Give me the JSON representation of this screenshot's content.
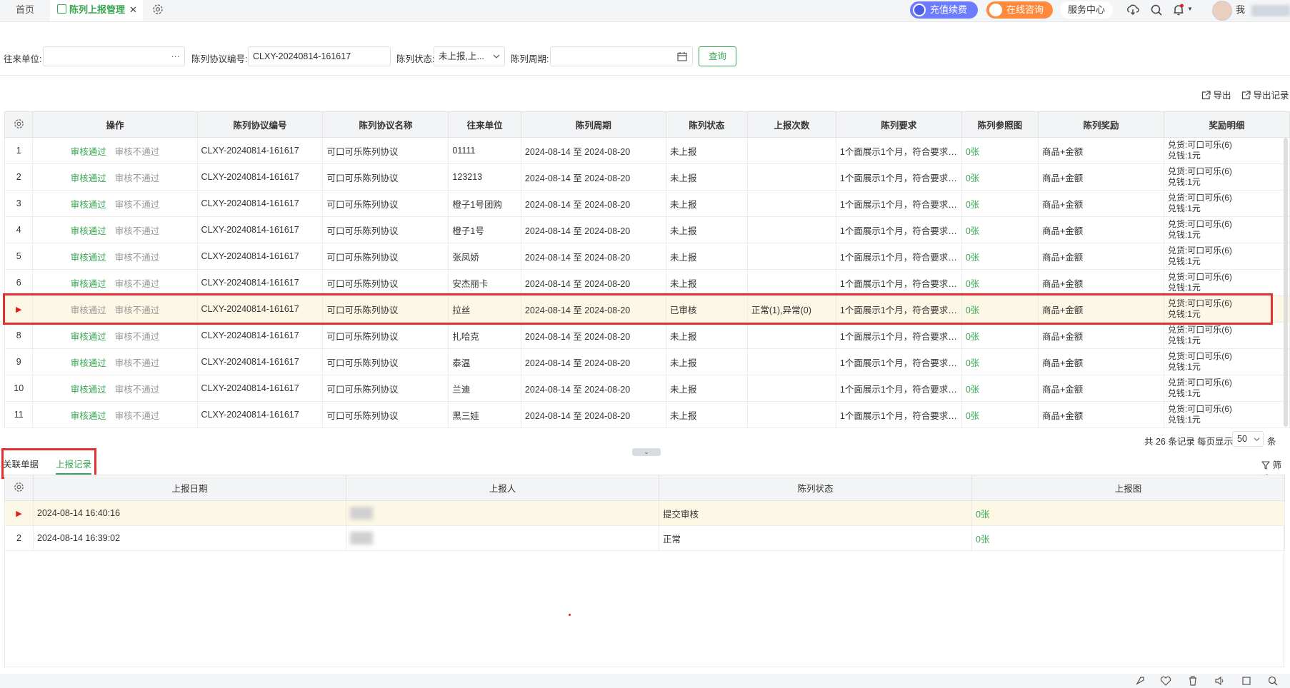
{
  "tabs": {
    "home": "首页",
    "active": "陈列上报管理",
    "close": "✕"
  },
  "topbar": {
    "recharge": "充值续费",
    "consult": "在线咨询",
    "service": "服务中心",
    "username": "我"
  },
  "filters": {
    "unit_label": "往来单位:",
    "unit_value": "",
    "unit_more": "···",
    "protocol_label": "陈列协议编号:",
    "protocol_value": "CLXY-20240814-161617",
    "status_label": "陈列状态:",
    "status_value": "未上报,上...",
    "period_label": "陈列周期:",
    "period_value": "",
    "query": "查询"
  },
  "toolbar": {
    "export": "导出",
    "export_log": "导出记录"
  },
  "table": {
    "headers": [
      "操作",
      "陈列协议编号",
      "陈列协议名称",
      "往来单位",
      "陈列周期",
      "陈列状态",
      "上报次数",
      "陈列要求",
      "陈列参照图",
      "陈列奖励",
      "奖励明细"
    ],
    "approve": "审核通过",
    "reject": "审核不通过",
    "rows": [
      {
        "idx": "1",
        "code": "CLXY-20240814-161617",
        "name": "可口可乐陈列协议",
        "unit": "01111",
        "period": "2024-08-14 至 2024-08-20",
        "status": "未上报",
        "count": "",
        "req": "1个面展示1个月，符合要求1...",
        "img": "0张",
        "reward": "商品+金额",
        "d1": "兑货:可口可乐(6)",
        "d2": "兑钱:1元"
      },
      {
        "idx": "2",
        "code": "CLXY-20240814-161617",
        "name": "可口可乐陈列协议",
        "unit": "123213",
        "period": "2024-08-14 至 2024-08-20",
        "status": "未上报",
        "count": "",
        "req": "1个面展示1个月，符合要求1...",
        "img": "0张",
        "reward": "商品+金额",
        "d1": "兑货:可口可乐(6)",
        "d2": "兑钱:1元"
      },
      {
        "idx": "3",
        "code": "CLXY-20240814-161617",
        "name": "可口可乐陈列协议",
        "unit": "橙子1号团购",
        "period": "2024-08-14 至 2024-08-20",
        "status": "未上报",
        "count": "",
        "req": "1个面展示1个月，符合要求1...",
        "img": "0张",
        "reward": "商品+金额",
        "d1": "兑货:可口可乐(6)",
        "d2": "兑钱:1元"
      },
      {
        "idx": "4",
        "code": "CLXY-20240814-161617",
        "name": "可口可乐陈列协议",
        "unit": "橙子1号",
        "period": "2024-08-14 至 2024-08-20",
        "status": "未上报",
        "count": "",
        "req": "1个面展示1个月，符合要求1...",
        "img": "0张",
        "reward": "商品+金额",
        "d1": "兑货:可口可乐(6)",
        "d2": "兑钱:1元"
      },
      {
        "idx": "5",
        "code": "CLXY-20240814-161617",
        "name": "可口可乐陈列协议",
        "unit": "张凤娇",
        "period": "2024-08-14 至 2024-08-20",
        "status": "未上报",
        "count": "",
        "req": "1个面展示1个月，符合要求1...",
        "img": "0张",
        "reward": "商品+金额",
        "d1": "兑货:可口可乐(6)",
        "d2": "兑钱:1元"
      },
      {
        "idx": "6",
        "code": "CLXY-20240814-161617",
        "name": "可口可乐陈列协议",
        "unit": "安杰丽卡",
        "period": "2024-08-14 至 2024-08-20",
        "status": "未上报",
        "count": "",
        "req": "1个面展示1个月，符合要求1...",
        "img": "0张",
        "reward": "商品+金额",
        "d1": "兑货:可口可乐(6)",
        "d2": "兑钱:1元"
      },
      {
        "idx": "▶",
        "code": "CLXY-20240814-161617",
        "name": "可口可乐陈列协议",
        "unit": "拉丝",
        "period": "2024-08-14 至 2024-08-20",
        "status": "已审核",
        "count": "正常(1),异常(0)",
        "req": "1个面展示1个月，符合要求1...",
        "img": "0张",
        "reward": "商品+金额",
        "d1": "兑货:可口可乐(6)",
        "d2": "兑钱:1元"
      },
      {
        "idx": "8",
        "code": "CLXY-20240814-161617",
        "name": "可口可乐陈列协议",
        "unit": "扎哈克",
        "period": "2024-08-14 至 2024-08-20",
        "status": "未上报",
        "count": "",
        "req": "1个面展示1个月，符合要求1...",
        "img": "0张",
        "reward": "商品+金额",
        "d1": "兑货:可口可乐(6)",
        "d2": "兑钱:1元"
      },
      {
        "idx": "9",
        "code": "CLXY-20240814-161617",
        "name": "可口可乐陈列协议",
        "unit": "泰温",
        "period": "2024-08-14 至 2024-08-20",
        "status": "未上报",
        "count": "",
        "req": "1个面展示1个月，符合要求1...",
        "img": "0张",
        "reward": "商品+金额",
        "d1": "兑货:可口可乐(6)",
        "d2": "兑钱:1元"
      },
      {
        "idx": "10",
        "code": "CLXY-20240814-161617",
        "name": "可口可乐陈列协议",
        "unit": "兰迪",
        "period": "2024-08-14 至 2024-08-20",
        "status": "未上报",
        "count": "",
        "req": "1个面展示1个月，符合要求1...",
        "img": "0张",
        "reward": "商品+金额",
        "d1": "兑货:可口可乐(6)",
        "d2": "兑钱:1元"
      },
      {
        "idx": "11",
        "code": "CLXY-20240814-161617",
        "name": "可口可乐陈列协议",
        "unit": "黑三娃",
        "period": "2024-08-14 至 2024-08-20",
        "status": "未上报",
        "count": "",
        "req": "1个面展示1个月，符合要求1...",
        "img": "0张",
        "reward": "商品+金额",
        "d1": "兑货:可口可乐(6)",
        "d2": "兑钱:1元"
      }
    ]
  },
  "pager": {
    "total": "共 26 条记录",
    "per_page_label": "每页显示",
    "per_page": "50",
    "unit": "条"
  },
  "bottom": {
    "tab_related": "关联单据",
    "tab_records": "上报记录",
    "filter": "筛选",
    "headers": [
      "上报日期",
      "上报人",
      "陈列状态",
      "上报图"
    ],
    "rows": [
      {
        "idx": "▶",
        "date": "2024-08-14 16:40:16",
        "status": "提交审核",
        "img": "0张"
      },
      {
        "idx": "2",
        "date": "2024-08-14 16:39:02",
        "status": "正常",
        "img": "0张"
      }
    ]
  },
  "colors": {
    "accent": "#3aa653",
    "highlight": "#e53030",
    "selected_row": "#fdf8e6"
  }
}
